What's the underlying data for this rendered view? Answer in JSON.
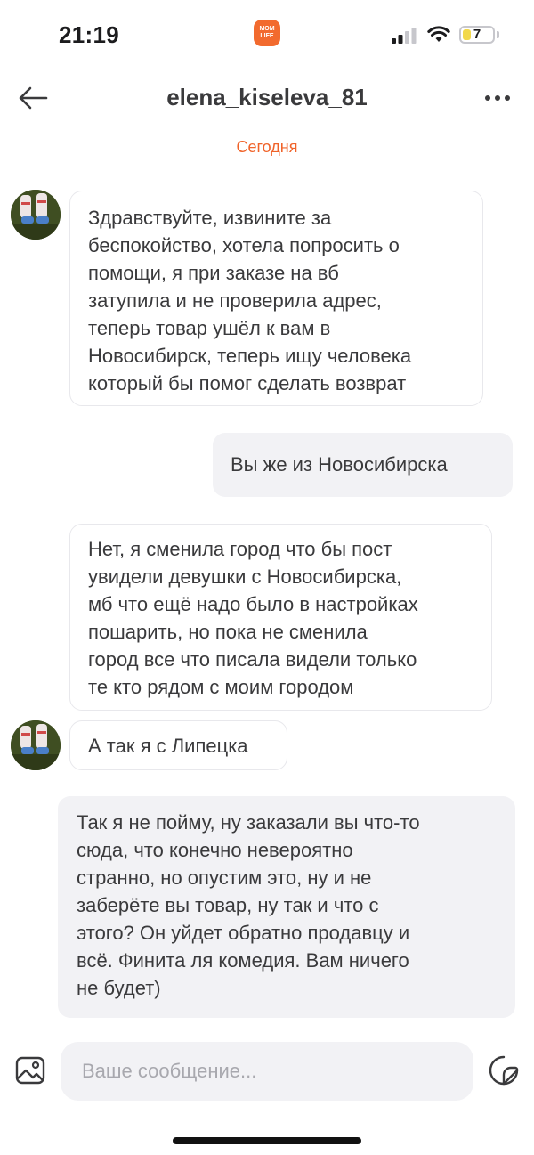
{
  "status_bar": {
    "time": "21:19",
    "app_badge_line1": "MOM",
    "app_badge_line2": "LIFE",
    "battery_level": "7",
    "battery_fraction": 0.07
  },
  "header": {
    "title": "elena_kiseleva_81"
  },
  "date_divider": "Сегодня",
  "messages": [
    {
      "side": "incoming",
      "avatar": true,
      "lines": [
        "Здравствуйте, извините за",
        "беспокойство, хотела попросить о",
        "помощи, я при заказе на вб",
        "затупила и не проверила адрес,",
        "теперь товар ушёл к вам в",
        "Новосибирск, теперь ищу человека",
        "который бы помог сделать возврат"
      ]
    },
    {
      "side": "outgoing",
      "lines": [
        "Вы же из Новосибирска"
      ]
    },
    {
      "side": "incoming",
      "avatar": false,
      "lines": [
        "Нет, я сменила город что бы пост",
        "увидели девушки с Новосибирска,",
        "мб что ещё надо было в настройках",
        "пошарить, но  пока не сменила",
        "город все что писала видели только",
        "те кто рядом с моим городом"
      ]
    },
    {
      "side": "incoming",
      "avatar": true,
      "lines": [
        "А так я с Липецка"
      ]
    },
    {
      "side": "outgoing",
      "lines": [
        "Так я не пойму, ну заказали вы что-то",
        "сюда, что конечно невероятно",
        "странно, но опустим это, ну и не",
        "заберёте вы товар, ну так и что с",
        "этого? Он уйдет обратно продавцу и",
        "всё. Финита ля комедия. Вам ничего",
        "не будет)"
      ]
    }
  ],
  "composer": {
    "placeholder": "Ваше сообщение..."
  },
  "colors": {
    "accent": "#f0632a",
    "bubble_outgoing": "#f2f2f5",
    "bubble_border": "#e8e8ec",
    "text": "#3a3a3c"
  },
  "icons": {
    "back": "arrow-left-icon",
    "more": "more-horizontal-icon",
    "attach": "image-icon",
    "sticker": "sticker-icon",
    "signal": "cellular-signal-icon",
    "wifi": "wifi-icon",
    "battery": "battery-icon"
  }
}
